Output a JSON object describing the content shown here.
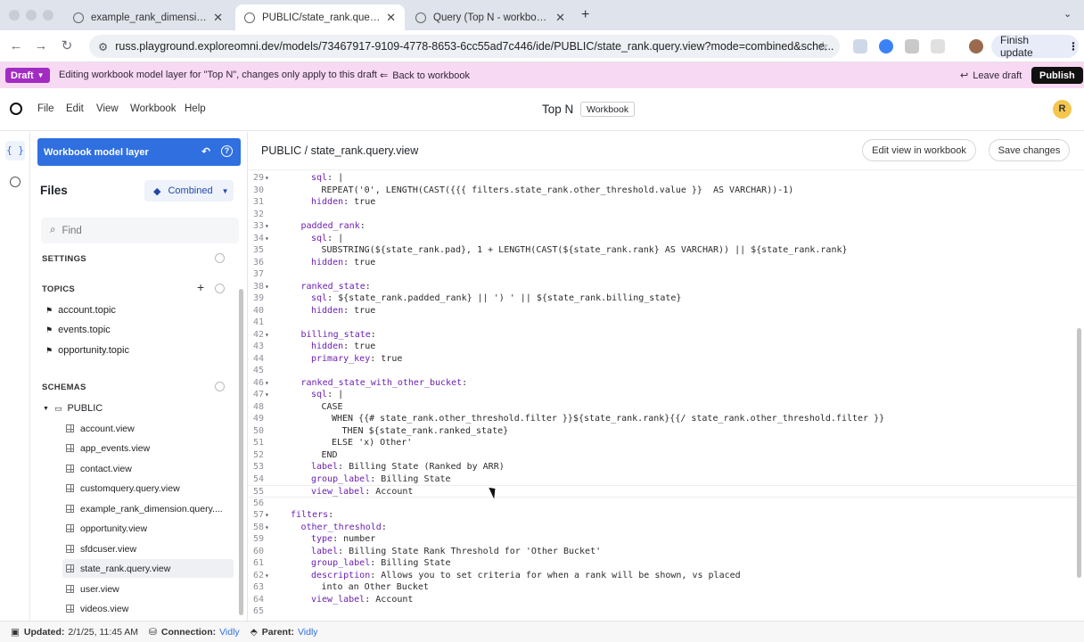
{
  "browser": {
    "tabs": [
      {
        "label": "example_rank_dimension (To",
        "active": false
      },
      {
        "label": "PUBLIC/state_rank.query.vie",
        "active": true
      },
      {
        "label": "Query (Top N - workbook)",
        "active": false
      }
    ],
    "url": "russ.playground.exploreomni.dev/models/73467917-9109-4778-8653-6cc55ad7c446/ide/PUBLIC/state_rank.query.view?mode=combined&sche...",
    "finish_update": "Finish update"
  },
  "draft_bar": {
    "badge": "Draft",
    "message": "Editing workbook model layer for \"Top N\", changes only apply to this draft",
    "back": "Back to workbook",
    "leave": "Leave draft",
    "publish": "Publish"
  },
  "app_header": {
    "menu": [
      "File",
      "Edit",
      "View",
      "Workbook",
      "Help"
    ],
    "title": "Top N",
    "badge": "Workbook",
    "avatar": "R"
  },
  "sidebar": {
    "model_layer": "Workbook model layer",
    "files_title": "Files",
    "mode": "Combined",
    "find_placeholder": "Find",
    "settings_label": "SETTINGS",
    "topics_label": "TOPICS",
    "topics": [
      "account.topic",
      "events.topic",
      "opportunity.topic"
    ],
    "schemas_label": "SCHEMAS",
    "schema_name": "PUBLIC",
    "views": [
      "account.view",
      "app_events.view",
      "contact.view",
      "customquery.query.view",
      "example_rank_dimension.query....",
      "opportunity.view",
      "sfdcuser.view",
      "state_rank.query.view",
      "user.view",
      "videos.view"
    ],
    "selected_view": "state_rank.query.view"
  },
  "main": {
    "title": "PUBLIC / state_rank.query.view",
    "edit_in_workbook": "Edit view in workbook",
    "save_changes": "Save changes",
    "current_line": 55,
    "lines": [
      {
        "n": 29,
        "fold": true,
        "indent": 2,
        "key": "sql",
        "rest": ": |"
      },
      {
        "n": 30,
        "fold": false,
        "indent": 3,
        "key": "",
        "rest": "REPEAT('0', LENGTH(CAST({{{ filters.state_rank.other_threshold.value }}  AS VARCHAR))-1)"
      },
      {
        "n": 31,
        "fold": false,
        "indent": 2,
        "key": "hidden",
        "rest": ": true"
      },
      {
        "n": 32,
        "fold": false,
        "indent": 0,
        "key": "",
        "rest": ""
      },
      {
        "n": 33,
        "fold": true,
        "indent": 1,
        "key": "padded_rank",
        "rest": ":"
      },
      {
        "n": 34,
        "fold": true,
        "indent": 2,
        "key": "sql",
        "rest": ": |"
      },
      {
        "n": 35,
        "fold": false,
        "indent": 3,
        "key": "",
        "rest": "SUBSTRING(${state_rank.pad}, 1 + LENGTH(CAST(${state_rank.rank} AS VARCHAR)) || ${state_rank.rank}"
      },
      {
        "n": 36,
        "fold": false,
        "indent": 2,
        "key": "hidden",
        "rest": ": true"
      },
      {
        "n": 37,
        "fold": false,
        "indent": 0,
        "key": "",
        "rest": ""
      },
      {
        "n": 38,
        "fold": true,
        "indent": 1,
        "key": "ranked_state",
        "rest": ":"
      },
      {
        "n": 39,
        "fold": false,
        "indent": 2,
        "key": "sql",
        "rest": ": ${state_rank.padded_rank} || ') ' || ${state_rank.billing_state}"
      },
      {
        "n": 40,
        "fold": false,
        "indent": 2,
        "key": "hidden",
        "rest": ": true"
      },
      {
        "n": 41,
        "fold": false,
        "indent": 0,
        "key": "",
        "rest": ""
      },
      {
        "n": 42,
        "fold": true,
        "indent": 1,
        "key": "billing_state",
        "rest": ":"
      },
      {
        "n": 43,
        "fold": false,
        "indent": 2,
        "key": "hidden",
        "rest": ": true"
      },
      {
        "n": 44,
        "fold": false,
        "indent": 2,
        "key": "primary_key",
        "rest": ": true"
      },
      {
        "n": 45,
        "fold": false,
        "indent": 0,
        "key": "",
        "rest": ""
      },
      {
        "n": 46,
        "fold": true,
        "indent": 1,
        "key": "ranked_state_with_other_bucket",
        "rest": ":"
      },
      {
        "n": 47,
        "fold": true,
        "indent": 2,
        "key": "sql",
        "rest": ": |"
      },
      {
        "n": 48,
        "fold": false,
        "indent": 3,
        "key": "",
        "rest": "CASE"
      },
      {
        "n": 49,
        "fold": false,
        "indent": 4,
        "key": "",
        "rest": "WHEN {{# state_rank.other_threshold.filter }}${state_rank.rank}{{/ state_rank.other_threshold.filter }}"
      },
      {
        "n": 50,
        "fold": false,
        "indent": 5,
        "key": "",
        "rest": "THEN ${state_rank.ranked_state}"
      },
      {
        "n": 51,
        "fold": false,
        "indent": 4,
        "key": "",
        "rest": "ELSE 'x) Other'"
      },
      {
        "n": 52,
        "fold": false,
        "indent": 3,
        "key": "",
        "rest": "END"
      },
      {
        "n": 53,
        "fold": false,
        "indent": 2,
        "key": "label",
        "rest": ": Billing State (Ranked by ARR)"
      },
      {
        "n": 54,
        "fold": false,
        "indent": 2,
        "key": "group_label",
        "rest": ": Billing State"
      },
      {
        "n": 55,
        "fold": false,
        "indent": 2,
        "key": "view_label",
        "rest": ": Account"
      },
      {
        "n": 56,
        "fold": false,
        "indent": 0,
        "key": "",
        "rest": ""
      },
      {
        "n": 57,
        "fold": true,
        "indent": 0,
        "key": "filters",
        "rest": ":"
      },
      {
        "n": 58,
        "fold": true,
        "indent": 1,
        "key": "other_threshold",
        "rest": ":"
      },
      {
        "n": 59,
        "fold": false,
        "indent": 2,
        "key": "type",
        "rest": ": number"
      },
      {
        "n": 60,
        "fold": false,
        "indent": 2,
        "key": "label",
        "rest": ": Billing State Rank Threshold for 'Other Bucket'"
      },
      {
        "n": 61,
        "fold": false,
        "indent": 2,
        "key": "group_label",
        "rest": ": Billing State"
      },
      {
        "n": 62,
        "fold": true,
        "indent": 2,
        "key": "description",
        "rest": ": Allows you to set criteria for when a rank will be shown, vs placed"
      },
      {
        "n": 63,
        "fold": false,
        "indent": 3,
        "key": "",
        "rest": "into an Other Bucket"
      },
      {
        "n": 64,
        "fold": false,
        "indent": 2,
        "key": "view_label",
        "rest": ": Account"
      },
      {
        "n": 65,
        "fold": false,
        "indent": 0,
        "key": "",
        "rest": ""
      }
    ]
  },
  "status": {
    "updated_label": "Updated:",
    "updated_value": "2/1/25, 11:45 AM",
    "connection_label": "Connection:",
    "connection_value": "Vidly",
    "parent_label": "Parent:",
    "parent_value": "Vidly"
  },
  "colors": {
    "accent": "#2f6fe0",
    "draft_bg": "#f7d9f3",
    "draft_badge": "#a22cc2",
    "yaml_key": "#6c1fb2"
  }
}
